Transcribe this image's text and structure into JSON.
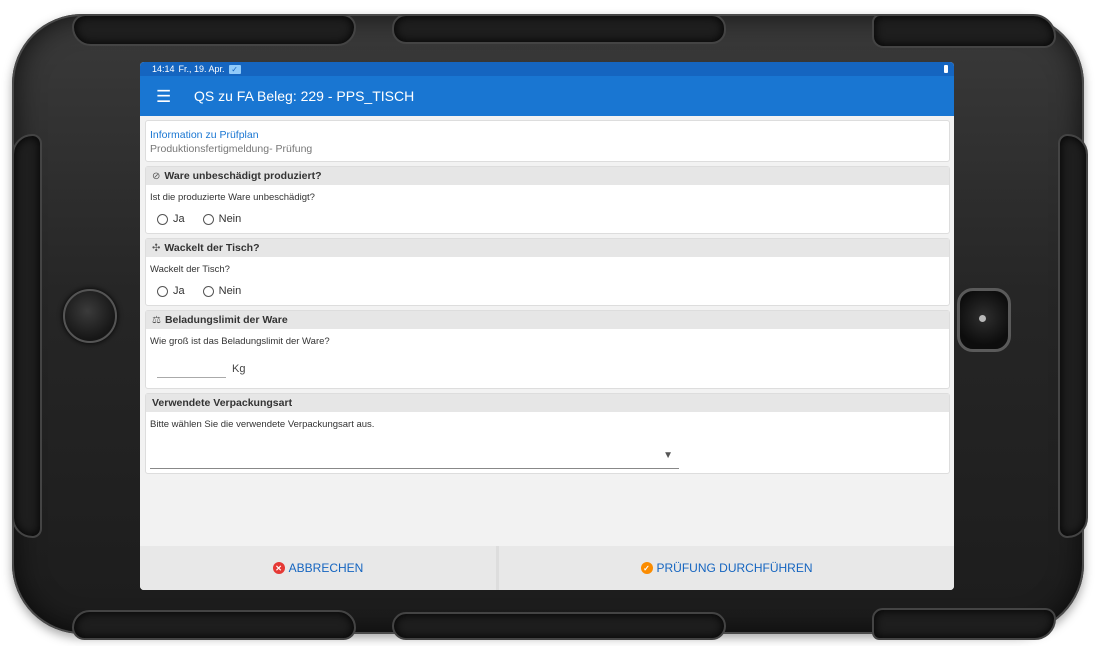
{
  "status_bar": {
    "time": "14:14",
    "date": "Fr., 19. Apr."
  },
  "app_bar": {
    "title": "QS zu FA Beleg: 229 - PPS_TISCH"
  },
  "info": {
    "title": "Information zu Prüfplan",
    "subtitle": "Produktionsfertigmeldung- Prüfung"
  },
  "sections": [
    {
      "icon": "ban-icon",
      "glyph": "⃠",
      "title": "Ware unbeschädigt produziert?",
      "question": "Ist die produzierte Ware unbeschädigt?",
      "options": [
        "Ja",
        "Nein"
      ]
    },
    {
      "icon": "arrows-icon",
      "glyph": "✣",
      "title": "Wackelt der Tisch?",
      "question": "Wackelt der Tisch?",
      "options": [
        "Ja",
        "Nein"
      ]
    },
    {
      "icon": "scale-icon",
      "glyph": "⚖",
      "title": "Beladungslimit der Ware",
      "question": "Wie groß ist das Beladungslimit der Ware?",
      "unit": "Kg",
      "value": ""
    },
    {
      "title": "Verwendete Verpackungsart",
      "question": "Bitte wählen Sie die verwendete Verpackungsart aus.",
      "selected": ""
    }
  ],
  "footer": {
    "cancel_label": "ABBRECHEN",
    "run_label": "PRÜFUNG DURCHFÜHREN"
  },
  "colors": {
    "primary": "#1976d2",
    "status": "#1565c0",
    "cancel_icon": "#e53935",
    "run_icon": "#fb8c00"
  }
}
